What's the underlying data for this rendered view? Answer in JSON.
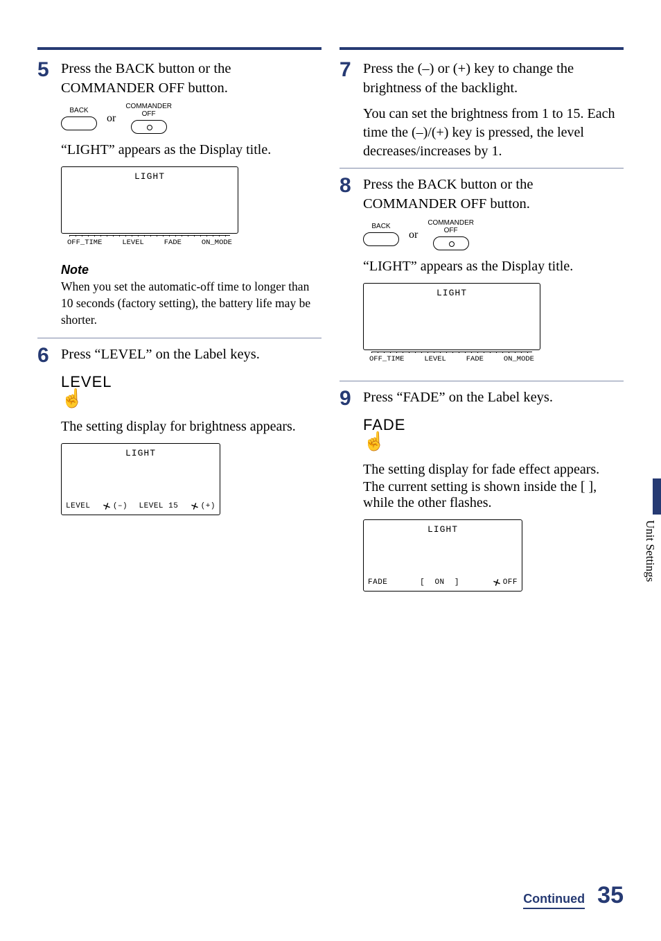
{
  "page": {
    "section_tab": "Unit Settings",
    "continued": "Continued",
    "number": "35"
  },
  "common": {
    "or": "or",
    "back_label": "BACK",
    "commander_off_label_l1": "COMMANDER",
    "commander_off_label_l2": "OFF",
    "light_appears": "“LIGHT” appears as the Display title.",
    "lcd_title": "LIGHT",
    "strip": {
      "a": "OFF_TIME",
      "b": "LEVEL",
      "c": "FADE",
      "d": "ON_MODE"
    }
  },
  "s5": {
    "num": "5",
    "text": "Press the BACK button or the COMMANDER OFF button.",
    "note_h": "Note",
    "note_b": "When you set the automatic-off time to longer than 10 seconds (factory setting), the battery life may be shorter."
  },
  "s6": {
    "num": "6",
    "text": "Press “LEVEL” on the Label keys.",
    "key": "LEVEL",
    "after": "The setting display for brightness appears.",
    "lcd": {
      "left": "LEVEL",
      "minus": "(–)",
      "mid": "LEVEL 15",
      "plus": "(+)"
    }
  },
  "s7": {
    "num": "7",
    "text": "Press the (–) or (+) key to change the brightness of the backlight.",
    "sub": "You can set the brightness from 1 to 15. Each time the (–)/(+) key is pressed, the level decreases/increases by 1."
  },
  "s8": {
    "num": "8",
    "text": "Press the BACK button or the COMMANDER OFF button."
  },
  "s9": {
    "num": "9",
    "text": "Press “FADE” on the Label keys.",
    "key": "FADE",
    "after1": "The setting display for fade effect appears.",
    "after2": "The current setting is shown inside the [ ], while the other flashes.",
    "lcd": {
      "left": "FADE",
      "on": "[  ON  ]",
      "off": "OFF"
    }
  }
}
